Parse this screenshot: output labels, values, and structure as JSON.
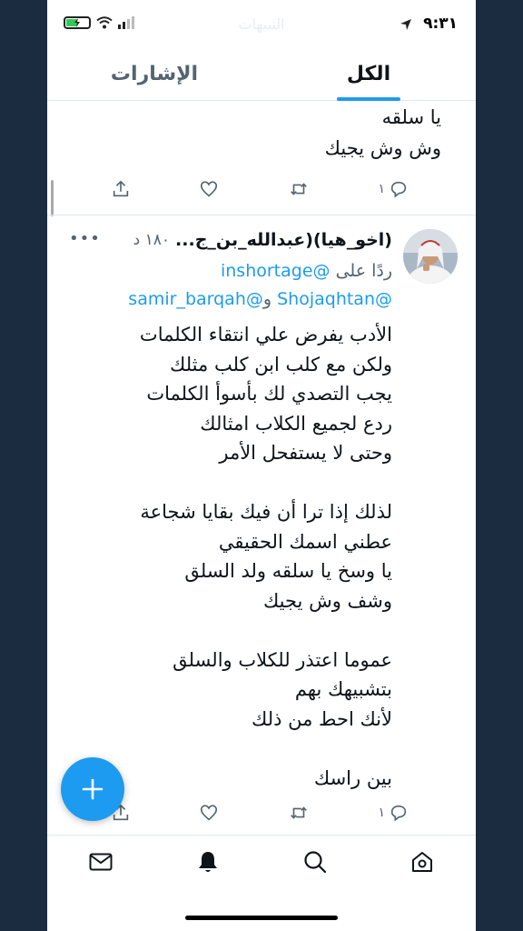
{
  "status_bar": {
    "time": "٩:٣١",
    "faded_title": "التبيهات"
  },
  "tabs": [
    {
      "label": "الكل",
      "active": true
    },
    {
      "label": "الإشارات",
      "active": false
    }
  ],
  "previous_tweet": {
    "lines": [
      "يا سلقه",
      "وش وش يجيك"
    ],
    "reply_count": "١"
  },
  "tweet": {
    "author_name": "(اخو_هيا)(عبدالله_بن_ج...",
    "time": "١٨٠ د",
    "reply_prefix": "ردًا على",
    "reply_to": "@inshortage",
    "mention_1": "@Shojaqhtan",
    "mention_and": "و",
    "mention_2": "@samir_barqah",
    "body": [
      "الأدب يفرض علي انتقاء الكلمات",
      "ولكن مع كلب ابن كلب مثلك",
      "يجب التصدي لك بأسوأ الكلمات",
      "ردع لجميع الكلاب امثالك",
      "وحتى لا يستفحل الأمر",
      "",
      "لذلك إذا ترا أن فيك بقايا شجاعة",
      "عطني اسمك الحقيقي",
      "يا وسخ يا سلقه ولد السلق",
      "وشف وش يجيك",
      "",
      "عموما اعتذر للكلاب والسلق",
      "بتشبيهك بهم",
      "لأنك احط من ذلك",
      "",
      "بين راسك"
    ],
    "reply_count": "١"
  },
  "colors": {
    "accent": "#1d9bf0",
    "text": "#0f1419",
    "muted": "#536471",
    "background": "#1b2c40"
  },
  "nav_icons": [
    "home-icon",
    "search-icon",
    "notifications-icon",
    "messages-icon"
  ]
}
